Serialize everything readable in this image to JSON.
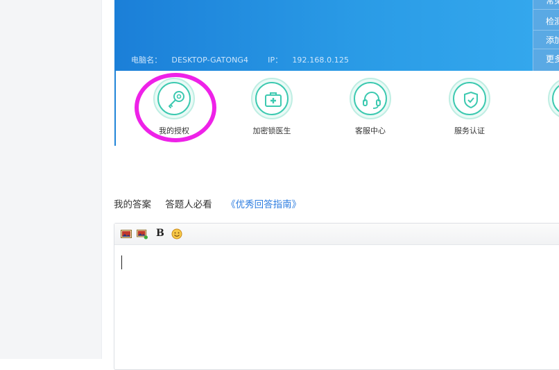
{
  "app": {
    "banner": {
      "computer_name_label": "电脑名：",
      "computer_name": "DESKTOP-GATONG4",
      "ip_label": "IP：",
      "ip": "192.168.0.125"
    },
    "side_menu": [
      "常见",
      "检测",
      "添加",
      "更多"
    ],
    "features": [
      {
        "label": "我的授权",
        "icon": "key-icon"
      },
      {
        "label": "加密锁医生",
        "icon": "medical-kit-icon"
      },
      {
        "label": "客服中心",
        "icon": "headset-icon"
      },
      {
        "label": "服务认证",
        "icon": "shield-check-icon"
      }
    ],
    "colors": {
      "banner": "#1b7fd8",
      "teal": "#3cc9b0",
      "highlight": "#ee22e8"
    }
  },
  "answer": {
    "tab_my_answer": "我的答案",
    "tab_must_read": "答题人必看",
    "guide_link": "《优秀回答指南》"
  },
  "editor": {
    "toolbar": {
      "image_icon": "image-icon",
      "insert_image_icon": "insert-image-icon",
      "bold_label": "B",
      "emoji_icon": "emoji-icon"
    },
    "content": ""
  }
}
